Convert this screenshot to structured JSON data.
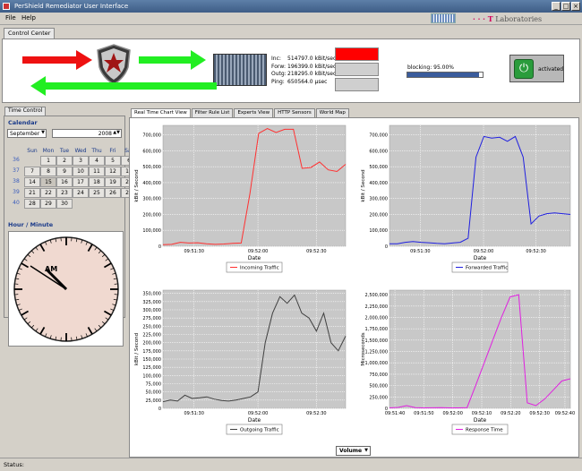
{
  "window": {
    "title": "PerShield Remediator User Interface"
  },
  "menu": [
    {
      "label": "File"
    },
    {
      "label": "Help"
    }
  ],
  "branding": {
    "lab_prefix": "· · · T",
    "lab_name": "Laboratories",
    "accent": "#d6005c"
  },
  "control_center": {
    "tab_label": "Control Center",
    "stats": [
      {
        "label": "Inc:",
        "value": "514797.0 kBit/sec"
      },
      {
        "label": "Forw:",
        "value": "196399.0 kBit/sec"
      },
      {
        "label": "Outg:",
        "value": "218295.0 kBit/sec"
      },
      {
        "label": "Ping:",
        "value": "650564.0 μsec"
      }
    ],
    "indicators": [
      "#ff0000",
      "#cfcfcf",
      "#cfcfcf"
    ],
    "blocking": {
      "label": "blocking: 95.00%",
      "fraction": 0.95
    },
    "activate": {
      "label": "activated",
      "icon": "power-icon"
    }
  },
  "time_control": {
    "tab_label": "Time Control",
    "calendar_label": "Calendar",
    "month": "September",
    "year": "2008",
    "weekdays": [
      "Sun",
      "Mon",
      "Tue",
      "Wed",
      "Thu",
      "Fri",
      "Sat"
    ],
    "weeks": [
      {
        "num": "36",
        "days": [
          "",
          "1",
          "2",
          "3",
          "4",
          "5",
          "6"
        ]
      },
      {
        "num": "37",
        "days": [
          "7",
          "8",
          "9",
          "10",
          "11",
          "12",
          "13"
        ]
      },
      {
        "num": "38",
        "days": [
          "14",
          "15",
          "16",
          "17",
          "18",
          "19",
          "20"
        ]
      },
      {
        "num": "39",
        "days": [
          "21",
          "22",
          "23",
          "24",
          "25",
          "26",
          "27"
        ]
      },
      {
        "num": "40",
        "days": [
          "28",
          "29",
          "30",
          "",
          "",
          "",
          ""
        ]
      }
    ],
    "clock_label": "Hour / Minute",
    "ampm": "AM"
  },
  "chart_tabs": [
    {
      "label": "Real Time Chart View",
      "active": true
    },
    {
      "label": "Filter Rule List",
      "active": false
    },
    {
      "label": "Experts View",
      "active": false
    },
    {
      "label": "HTTP Sensors",
      "active": false
    },
    {
      "label": "World Map",
      "active": false
    }
  ],
  "volume_label": "Volume",
  "status_label": "Status:",
  "chart_data": [
    {
      "type": "line",
      "xlabel": "Date",
      "ylabel": "kBit / Second",
      "color": "#ff3030",
      "ylim": [
        0,
        760000
      ],
      "yticks": [
        "0",
        "100,000",
        "200,000",
        "300,000",
        "400,000",
        "500,000",
        "600,000",
        "700,000"
      ],
      "ytick_values": [
        0,
        100000,
        200000,
        300000,
        400000,
        500000,
        600000,
        700000
      ],
      "xticks": [
        "09:51:30",
        "09:52:00",
        "09:52:30"
      ],
      "xtick_pos": [
        0.17,
        0.52,
        0.84
      ],
      "series": [
        {
          "name": "Incoming Traffic",
          "values": [
            10000,
            12000,
            25000,
            20000,
            22000,
            15000,
            12000,
            14000,
            18000,
            20000,
            330000,
            710000,
            740000,
            715000,
            735000,
            735000,
            490000,
            495000,
            530000,
            480000,
            470000,
            515000
          ]
        }
      ]
    },
    {
      "type": "line",
      "xlabel": "Date",
      "ylabel": "kBit / Second",
      "color": "#2020e0",
      "ylim": [
        0,
        760000
      ],
      "yticks": [
        "0",
        "100,000",
        "200,000",
        "300,000",
        "400,000",
        "500,000",
        "600,000",
        "700,000"
      ],
      "ytick_values": [
        0,
        100000,
        200000,
        300000,
        400000,
        500000,
        600000,
        700000
      ],
      "xticks": [
        "09:51:30",
        "09:52:00",
        "09:52:30"
      ],
      "xtick_pos": [
        0.17,
        0.52,
        0.81
      ],
      "series": [
        {
          "name": "Forwarded Traffic",
          "values": [
            15000,
            15000,
            25000,
            30000,
            25000,
            22000,
            18000,
            15000,
            20000,
            25000,
            50000,
            560000,
            690000,
            680000,
            685000,
            660000,
            690000,
            560000,
            140000,
            190000,
            205000,
            210000,
            205000,
            200000
          ]
        }
      ]
    },
    {
      "type": "line",
      "xlabel": "Date",
      "ylabel": "kBit / Second",
      "color": "#404040",
      "ylim": [
        0,
        360000
      ],
      "yticks": [
        "0",
        "25,000",
        "50,000",
        "75,000",
        "100,000",
        "125,000",
        "150,000",
        "175,000",
        "200,000",
        "225,000",
        "250,000",
        "275,000",
        "300,000",
        "325,000",
        "350,000"
      ],
      "ytick_values": [
        0,
        25000,
        50000,
        75000,
        100000,
        125000,
        150000,
        175000,
        200000,
        225000,
        250000,
        275000,
        300000,
        325000,
        350000
      ],
      "xticks": [
        "09:51:30",
        "09:52:00",
        "09:52:30"
      ],
      "xtick_pos": [
        0.17,
        0.52,
        0.84
      ],
      "series": [
        {
          "name": "Outgoing Traffic",
          "values": [
            20000,
            25000,
            22000,
            40000,
            30000,
            32000,
            35000,
            28000,
            24000,
            22000,
            25000,
            30000,
            35000,
            50000,
            200000,
            290000,
            340000,
            320000,
            345000,
            290000,
            275000,
            235000,
            290000,
            200000,
            175000,
            220000
          ]
        }
      ]
    },
    {
      "type": "line",
      "xlabel": "Date",
      "ylabel": "Microseconds",
      "color": "#e020e0",
      "ylim": [
        0,
        2600000
      ],
      "yticks": [
        "0",
        "250,000",
        "500,000",
        "750,000",
        "1,000,000",
        "1,250,000",
        "1,500,000",
        "1,750,000",
        "2,000,000",
        "2,250,000",
        "2,500,000"
      ],
      "ytick_values": [
        0,
        250000,
        500000,
        750000,
        1000000,
        1250000,
        1500000,
        1750000,
        2000000,
        2250000,
        2500000
      ],
      "xticks": [
        "09:51:40",
        "09:51:50",
        "09:52:00",
        "09:52:10",
        "09:52:20",
        "09:52:30",
        "09:52:40"
      ],
      "xtick_pos": [
        0.03,
        0.19,
        0.35,
        0.51,
        0.67,
        0.83,
        0.97
      ],
      "series": [
        {
          "name": "Response Time",
          "values": [
            10000,
            20000,
            60000,
            15000,
            10000,
            12000,
            15000,
            10000,
            10000,
            15000,
            500000,
            1000000,
            1500000,
            2000000,
            2450000,
            2500000,
            120000,
            60000,
            200000,
            400000,
            600000,
            650000
          ]
        }
      ]
    }
  ]
}
